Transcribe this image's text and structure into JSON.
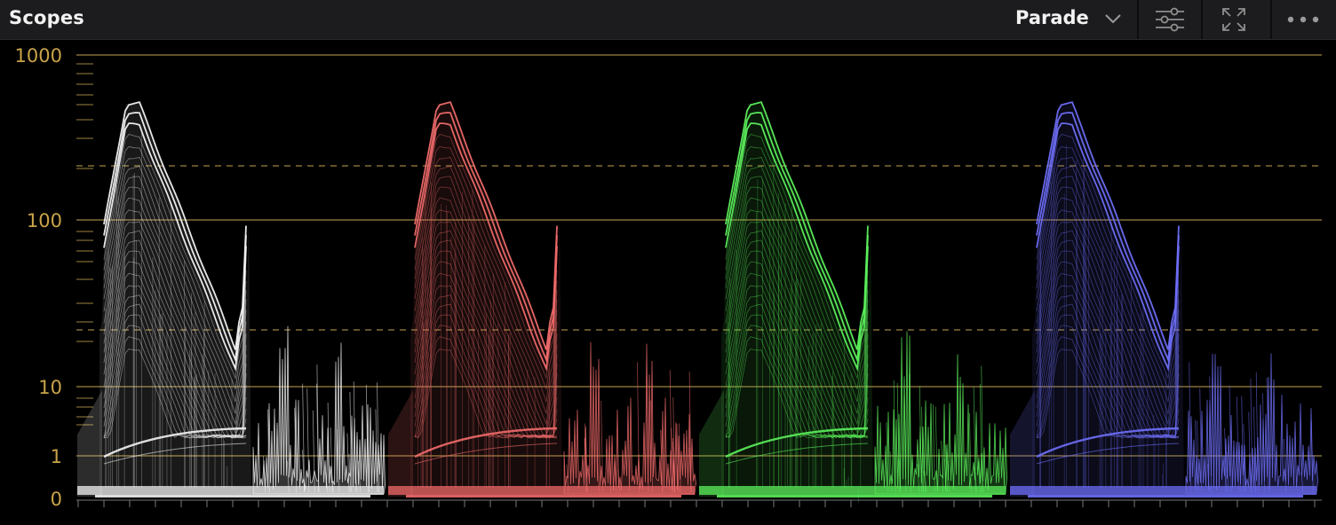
{
  "window": {
    "title": "Scopes"
  },
  "toolbar": {
    "mode": "Parade",
    "icons": [
      "chevron-down-icon",
      "settings-sliders-icon",
      "expand-icon",
      "more-options-icon"
    ]
  },
  "scope": {
    "y_axis": {
      "labels": [
        "1000",
        "100",
        "10",
        "1",
        "0"
      ],
      "scale": "log"
    },
    "channels": [
      {
        "name": "luma",
        "color": "#f2f2f2"
      },
      {
        "name": "red",
        "color": "#f06a6a"
      },
      {
        "name": "green",
        "color": "#5cf05c"
      },
      {
        "name": "blue",
        "color": "#6e6ef8"
      }
    ],
    "guide_color": "#9c8240",
    "label_color": "#c9a349"
  }
}
